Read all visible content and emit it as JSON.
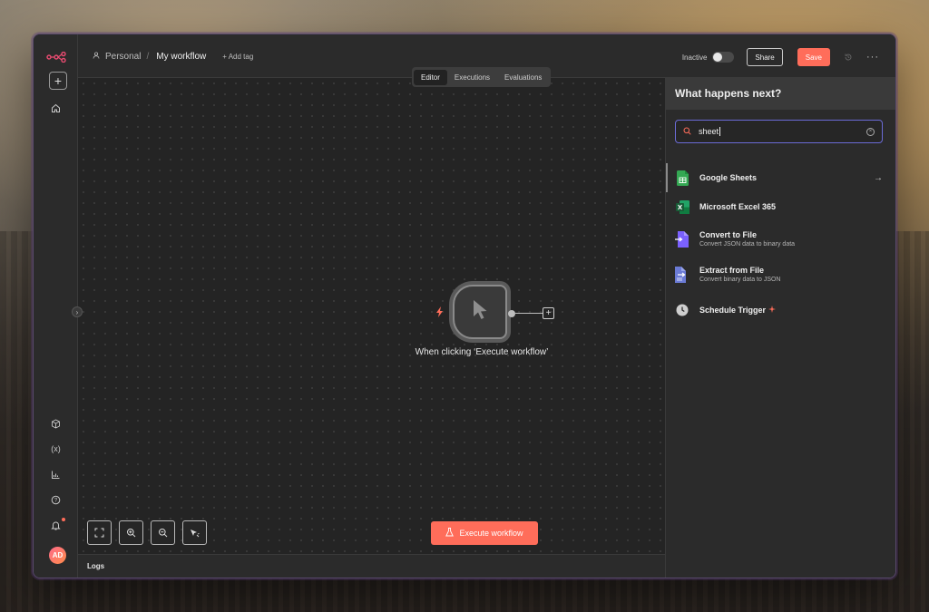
{
  "header": {
    "breadcrumb_project": "Personal",
    "breadcrumb_separator": "/",
    "workflow_name": "My workflow",
    "add_tag": "+ Add tag",
    "status_label": "Inactive",
    "share_label": "Share",
    "save_label": "Save",
    "more_label": "···"
  },
  "tabs": [
    {
      "label": "Editor",
      "active": true
    },
    {
      "label": "Executions",
      "active": false
    },
    {
      "label": "Evaluations",
      "active": false
    }
  ],
  "sidebar": {
    "icons": [
      "n8n-logo-icon",
      "add-icon",
      "home-icon",
      "templates-icon",
      "variables-icon",
      "insights-icon",
      "help-icon",
      "notifications-icon"
    ],
    "avatar_initials": "AD"
  },
  "canvas": {
    "node_label": "When clicking ‘Execute workflow’",
    "execute_label": "Execute workflow",
    "controls": [
      "fit-view-icon",
      "zoom-in-icon",
      "zoom-out-icon",
      "tidy-up-icon"
    ]
  },
  "logs": {
    "label": "Logs"
  },
  "panel": {
    "title": "What happens next?",
    "search_value": "sheet",
    "results": [
      {
        "title": "Google Sheets",
        "subtitle": "",
        "icon": "google-sheets-icon",
        "color": "#34a853"
      },
      {
        "title": "Microsoft Excel 365",
        "subtitle": "",
        "icon": "excel-icon",
        "color": "#1e7145"
      },
      {
        "title": "Convert to File",
        "subtitle": "Convert JSON data to binary data",
        "icon": "convert-file-icon",
        "color": "#7b61ff"
      },
      {
        "title": "Extract from File",
        "subtitle": "Convert binary data to JSON",
        "icon": "extract-file-icon",
        "color": "#6b7bd6"
      },
      {
        "title": "Schedule Trigger",
        "subtitle": "",
        "icon": "clock-icon",
        "color": "#cfcfcf"
      }
    ]
  },
  "colors": {
    "accent": "#ff6d5a",
    "brand": "#ea4b71",
    "search_border": "#6b6bd6"
  }
}
